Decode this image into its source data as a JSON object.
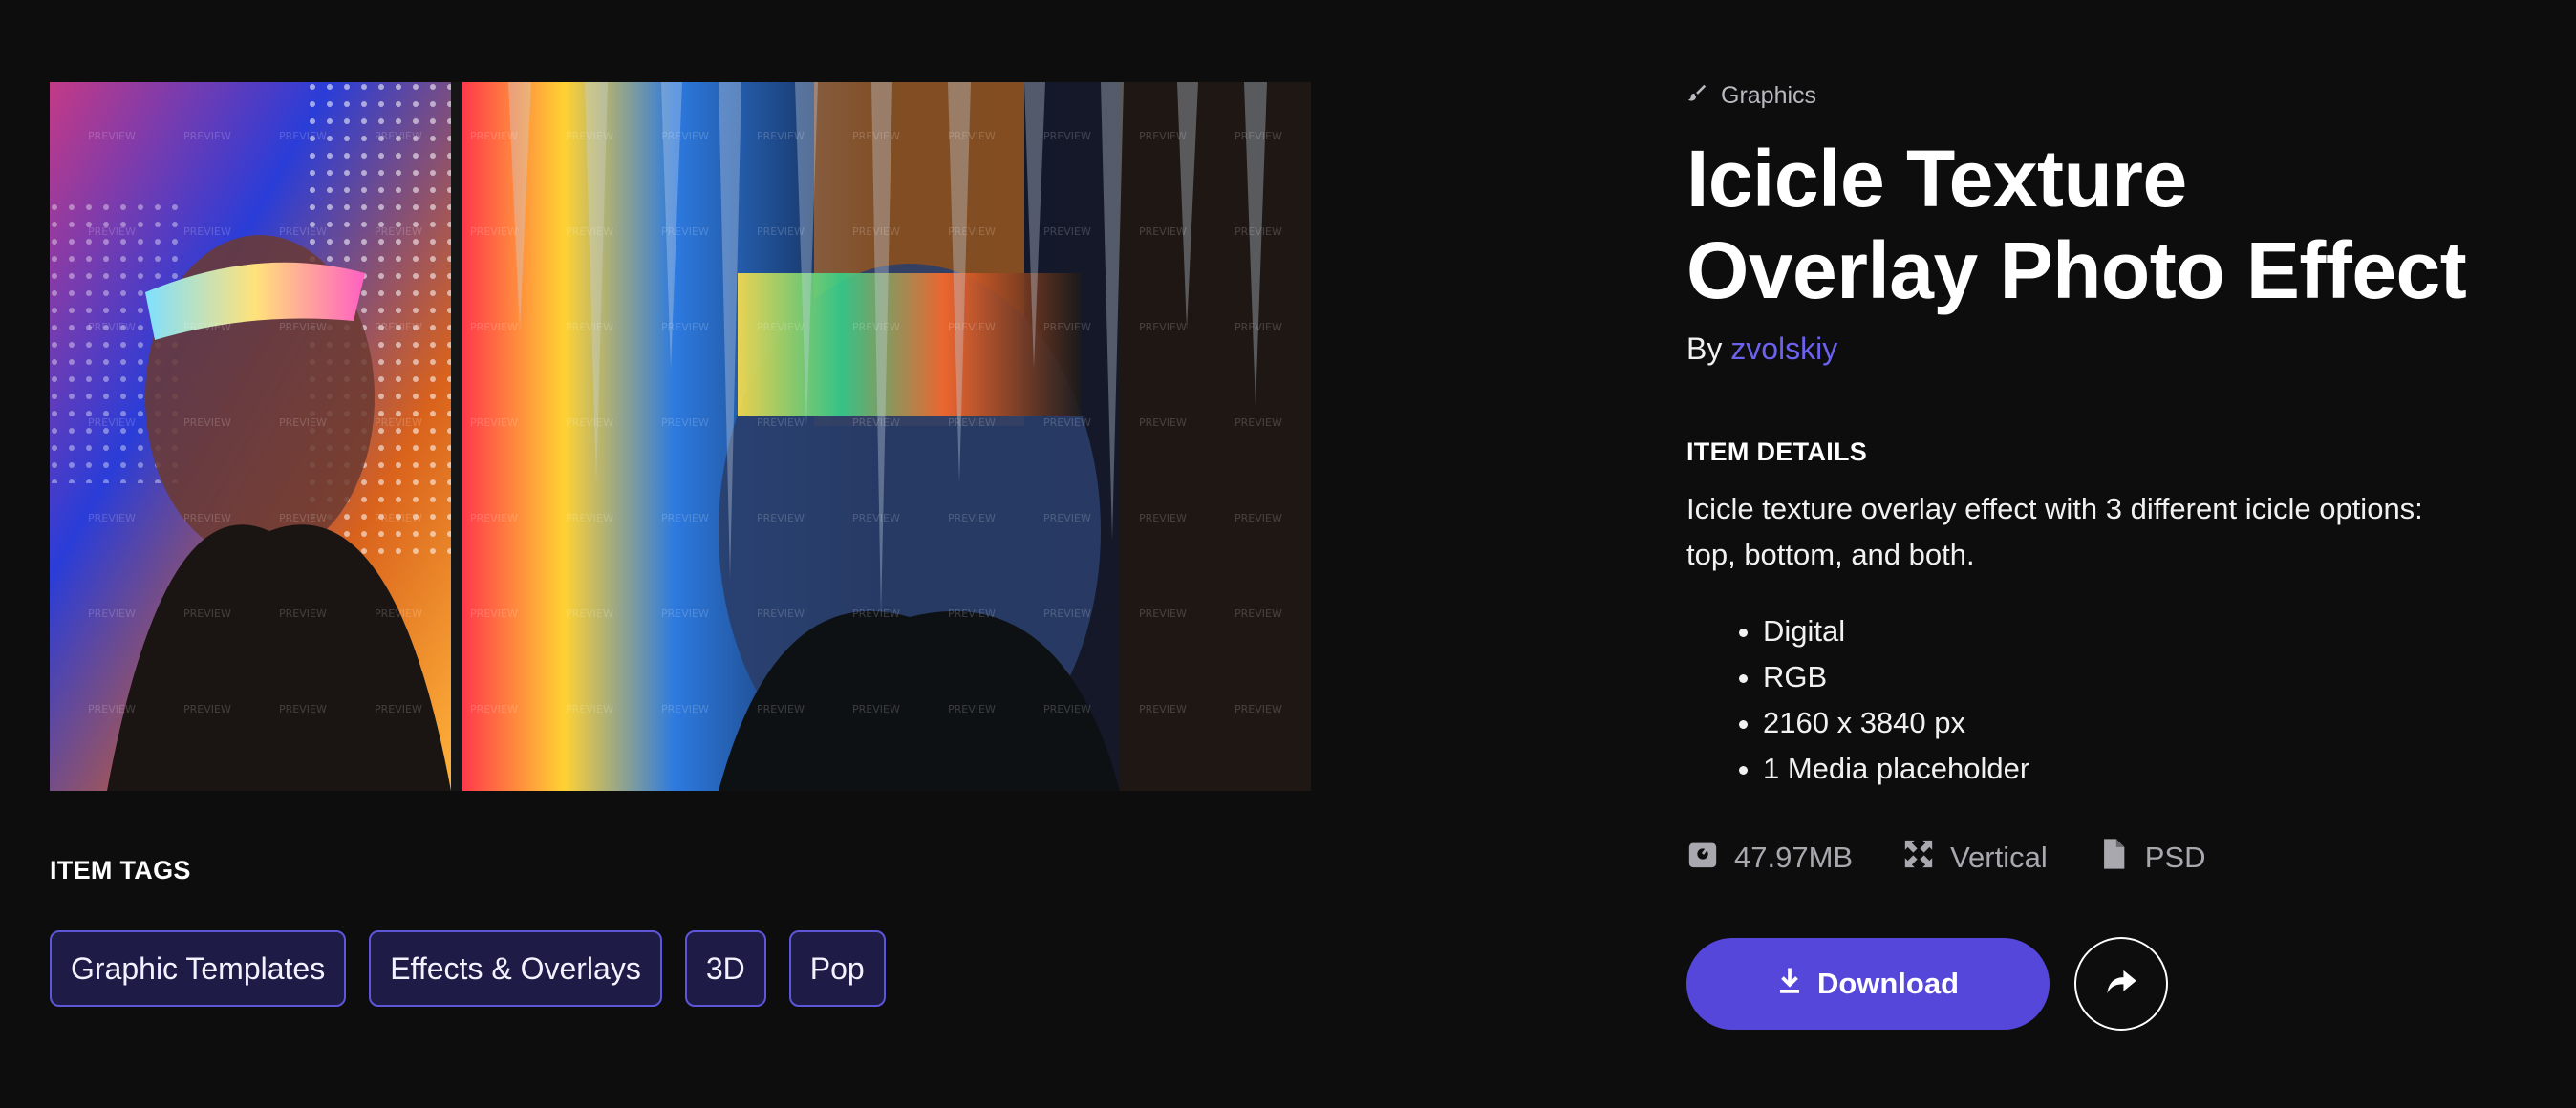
{
  "item": {
    "category_icon": "brush-icon",
    "category": "Graphics",
    "title_line1": "Icicle Texture",
    "title_line2": "Overlay Photo Effect",
    "by_label": "By",
    "author": "zvolskiy"
  },
  "preview": {
    "watermark": "PREVIEW"
  },
  "details": {
    "heading": "ITEM DETAILS",
    "description": "Icicle texture overlay effect with 3 different icicle options: top, bottom, and both.",
    "specs": [
      "Digital",
      "RGB",
      "2160 x 3840 px",
      "1 Media placeholder"
    ]
  },
  "meta": {
    "size": "47.97MB",
    "size_icon": "file-size-icon",
    "orientation": "Vertical",
    "orientation_icon": "expand-arrows-icon",
    "format": "PSD",
    "format_icon": "file-icon"
  },
  "actions": {
    "download_label": "Download",
    "download_icon": "download-icon",
    "share_icon": "share-arrow-icon"
  },
  "tags": {
    "heading": "ITEM TAGS",
    "items": [
      "Graphic Templates",
      "Effects & Overlays",
      "3D",
      "Pop"
    ]
  },
  "colors": {
    "background": "#0d0d0e",
    "accent": "#5547da",
    "author_link": "#6b62ee",
    "tag_bg": "#1e1c47",
    "tag_border": "#5e56d8"
  }
}
